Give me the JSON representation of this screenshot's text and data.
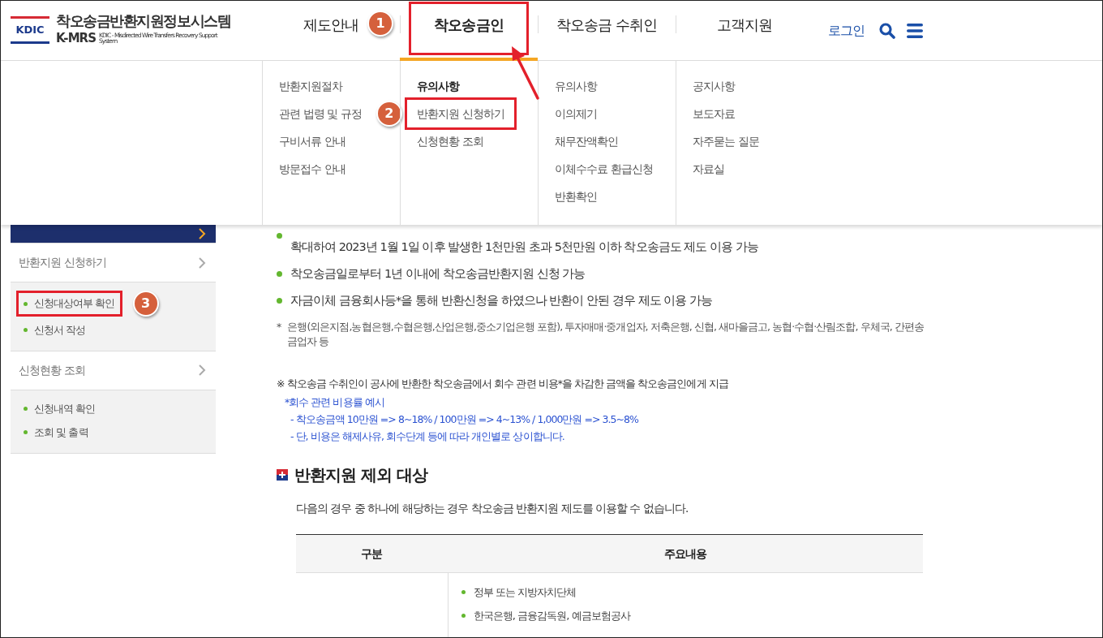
{
  "header": {
    "logo_mark": "KDIC",
    "title": "착오송금반환지원정보시스템",
    "short_name": "K-MRS",
    "long_name": "KDIC - Misdirected Wire Transfers Recovery Support System"
  },
  "nav": {
    "items": [
      {
        "label": "제도안내",
        "selected": false,
        "highlighted": false,
        "callout": "1"
      },
      {
        "label": "착오송금인",
        "selected": true,
        "highlighted": true
      },
      {
        "label": "착오송금 수취인",
        "selected": false,
        "highlighted": false
      },
      {
        "label": "고객지원",
        "selected": false,
        "highlighted": false
      }
    ],
    "login": "로그인"
  },
  "mega_menu": {
    "columns": [
      {
        "items": [
          {
            "label": "반환지원절차",
            "selected": false,
            "highlighted": false
          },
          {
            "label": "관련 법령 및 규정",
            "selected": false,
            "highlighted": false,
            "callout": "2"
          },
          {
            "label": "구비서류 안내",
            "selected": false,
            "highlighted": false
          },
          {
            "label": "방문접수 안내",
            "selected": false,
            "highlighted": false
          }
        ]
      },
      {
        "items": [
          {
            "label": "유의사항",
            "selected": true,
            "highlighted": false
          },
          {
            "label": "반환지원 신청하기",
            "selected": false,
            "highlighted": true
          },
          {
            "label": "신청현황 조회",
            "selected": false,
            "highlighted": false
          }
        ]
      },
      {
        "items": [
          {
            "label": "유의사항",
            "selected": false,
            "highlighted": false
          },
          {
            "label": "이의제기",
            "selected": false,
            "highlighted": false
          },
          {
            "label": "채무잔액확인",
            "selected": false,
            "highlighted": false
          },
          {
            "label": "이체수수료 환급신청",
            "selected": false,
            "highlighted": false
          },
          {
            "label": "반환확인",
            "selected": false,
            "highlighted": false
          }
        ]
      },
      {
        "items": [
          {
            "label": "공지사항",
            "selected": false,
            "highlighted": false
          },
          {
            "label": "보도자료",
            "selected": false,
            "highlighted": false
          },
          {
            "label": "자주묻는 질문",
            "selected": false,
            "highlighted": false
          },
          {
            "label": "자료실",
            "selected": false,
            "highlighted": false
          }
        ]
      }
    ]
  },
  "sidebar": {
    "items": [
      {
        "selected": true
      },
      {
        "label": "반환지원 신청하기",
        "selected": false,
        "children": [
          {
            "label": "신청대상여부 확인",
            "highlighted": true,
            "callout": "3"
          },
          {
            "label": "신청서 작성",
            "highlighted": false
          }
        ]
      },
      {
        "label": "신청현황 조회",
        "selected": false,
        "children": [
          {
            "label": "신청내역 확인",
            "highlighted": false
          },
          {
            "label": "조회 및 출력",
            "highlighted": false
          }
        ]
      }
    ]
  },
  "content": {
    "bullets": [
      "확대하여 2023년 1월 1일 이후 발생한 1천만원 초과 5천만원 이하 착오송금도 제도 이용 가능",
      "착오송금일로부터 1년 이내에 착오송금반환지원 신청 가능",
      "자금이체 금융회사등*을 통해 반환신청을 하였으나 반환이 안된 경우 제도 이용 가능"
    ],
    "footnote_mark": "*",
    "footnote": "은행(외은지점,농협은행,수협은행,산업은행,중소기업은행 포함), 투자매매·중개업자, 저축은행, 신협, 새마을금고, 농협·수협·산림조합, 우체국, 간편송금업자 등",
    "notice": "※ 착오송금 수취인이 공사에 반환한 착오송금에서 회수 관련 비용*을 차감한 금액을 착오송금인에게 지급",
    "notice_lines": [
      "*회수 관련 비용률 예시",
      "- 착오송금액 10만원 => 8~18% / 100만원 => 4~13% / 1,000만원 => 3.5~8%",
      "- 단, 비용은 해제사유, 회수단계 등에 따라 개인별로 상이합니다."
    ],
    "section": {
      "heading": "반환지원 제외 대상",
      "intro": "다음의 경우 중 하나에 해당하는 경우 착오송금 반환지원 제도를 이용할 수 없습니다.",
      "table": {
        "columns": [
          "구분",
          "주요내용"
        ],
        "rows": [
          {
            "items": [
              "정부 또는 지방자치단체",
              "한국은행, 금융감독원, 예금보험공사"
            ]
          }
        ]
      }
    }
  }
}
